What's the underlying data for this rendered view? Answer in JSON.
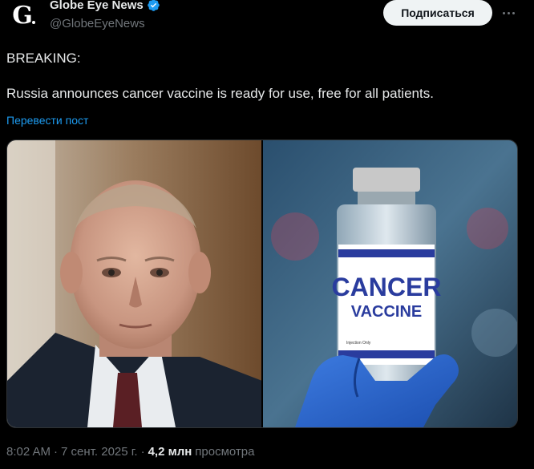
{
  "author": {
    "display_name": "Globe Eye News",
    "handle": "@GlobeEyeNews",
    "avatar_letter": "G"
  },
  "actions": {
    "subscribe_label": "Подписаться"
  },
  "post": {
    "text": "BREAKING:\n\nRussia announces cancer vaccine is ready for use, free for all patients.",
    "translate_label": "Перевести пост"
  },
  "media": {
    "vial_label_line1": "CANCER",
    "vial_label_line2": "VACCINE",
    "vial_small_text": "Injection Only"
  },
  "meta": {
    "time": "8:02 AM",
    "separator1": "·",
    "date": "7 сент. 2025 г.",
    "separator2": "·",
    "views_count": "4,2 млн",
    "views_label": "просмотра"
  },
  "colors": {
    "background": "#000000",
    "text_primary": "#e7e9ea",
    "text_secondary": "#71767b",
    "link": "#1d9bf0",
    "verified": "#1d9bf0",
    "button_bg": "#eff3f4"
  },
  "icons": {
    "verified": "verified-badge-icon",
    "more": "more-dots-icon"
  }
}
